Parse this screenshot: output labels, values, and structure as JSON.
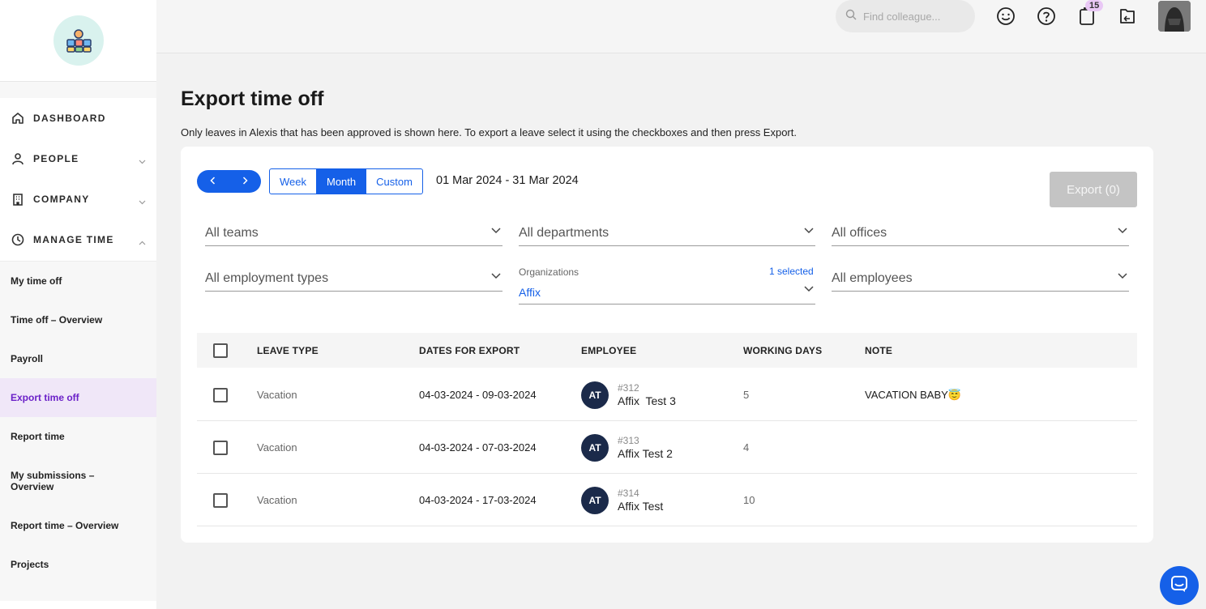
{
  "sidebar": {
    "main_items": [
      {
        "label": "DASHBOARD",
        "icon": "home-icon"
      },
      {
        "label": "PEOPLE",
        "icon": "person-icon"
      },
      {
        "label": "COMPANY",
        "icon": "building-icon"
      },
      {
        "label": "MANAGE TIME",
        "icon": "clock-icon"
      }
    ],
    "sub_items": [
      {
        "label": "My time off"
      },
      {
        "label": "Time off – Overview"
      },
      {
        "label": "Payroll"
      },
      {
        "label": "Export time off"
      },
      {
        "label": "Report time"
      },
      {
        "label": "My submissions – Overview"
      },
      {
        "label": "Report time – Overview"
      },
      {
        "label": "Projects"
      }
    ]
  },
  "topbar": {
    "search_placeholder": "Find colleague...",
    "notifications_count": "15"
  },
  "page": {
    "title": "Export time off",
    "description": "Only leaves in Alexis that has been approved is shown here. To export a leave select it using the checkboxes and then press Export."
  },
  "period": {
    "options": [
      "Week",
      "Month",
      "Custom"
    ],
    "selected": "Month",
    "range": "01 Mar 2024 - 31 Mar 2024"
  },
  "export_button": "Export (0)",
  "filters": {
    "teams": "All teams",
    "departments": "All departments",
    "offices": "All offices",
    "employment_types": "All employment types",
    "organizations_label": "Organizations",
    "organizations_selected": "1 selected",
    "organizations_value": "Affix",
    "employees": "All employees"
  },
  "table": {
    "headers": [
      "LEAVE TYPE",
      "DATES FOR EXPORT",
      "EMPLOYEE",
      "WORKING DAYS",
      "NOTE"
    ],
    "rows": [
      {
        "leave_type": "Vacation",
        "dates": "04-03-2024 - 09-03-2024",
        "initials": "AT",
        "emp_id": "#312",
        "emp_name": "Affix  Test 3",
        "working_days": "5",
        "note": "VACATION BABY😇"
      },
      {
        "leave_type": "Vacation",
        "dates": "04-03-2024 - 07-03-2024",
        "initials": "AT",
        "emp_id": "#313",
        "emp_name": "Affix Test 2",
        "working_days": "4",
        "note": ""
      },
      {
        "leave_type": "Vacation",
        "dates": "04-03-2024 - 17-03-2024",
        "initials": "AT",
        "emp_id": "#314",
        "emp_name": "Affix Test",
        "working_days": "10",
        "note": ""
      }
    ]
  },
  "colors": {
    "accent": "#1560e8",
    "active_nav_bg": "#f0e7f8",
    "active_nav_text": "#6b21c8",
    "avatar_bg": "#1b2a4a"
  }
}
